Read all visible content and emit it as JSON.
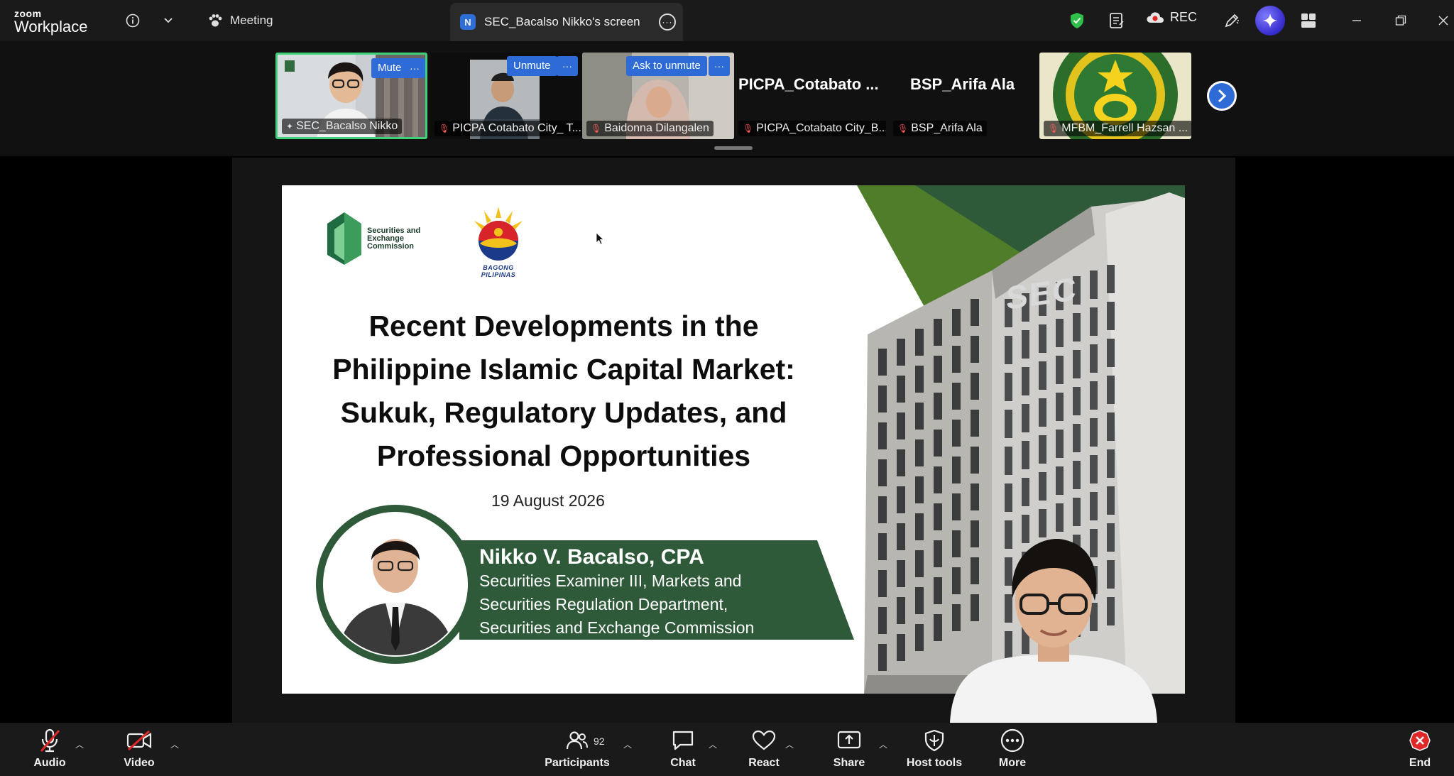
{
  "titlebar": {
    "brand_small": "zoom",
    "brand_large": "Workplace",
    "meeting_tab": "Meeting",
    "screen_tab": "SEC_Bacalso Nikko's screen",
    "screen_tab_badge": "N",
    "rec": "REC"
  },
  "gallery": {
    "tiles": [
      {
        "name": "SEC_Bacalso Nikko",
        "button": "Mute"
      },
      {
        "name": "PICPA Cotabato City_ T...",
        "button": "Unmute"
      },
      {
        "name": "Baidonna Dilangalen",
        "button": "Ask to unmute"
      },
      {
        "name": "PICPA_Cotabato City_B...",
        "display": "PICPA_Cotabato ..."
      },
      {
        "name": "BSP_Arifa Ala",
        "display": "BSP_Arifa Ala"
      },
      {
        "name": "MFBM_Farrell Hazsan ..."
      }
    ]
  },
  "slide": {
    "org_logo_text": [
      "Securities and",
      "Exchange",
      "Commission"
    ],
    "bp_logo_text": "BAGONG PILIPINAS",
    "title_lines": [
      "Recent Developments in the",
      "Philippine Islamic Capital Market:",
      "Sukuk, Regulatory Updates, and",
      "Professional Opportunities"
    ],
    "date": "19 August 2026",
    "speaker_name": "Nikko V. Bacalso, CPA",
    "speaker_role_lines": [
      "Securities Examiner III, Markets and",
      "Securities Regulation Department,",
      "Securities and Exchange Commission"
    ],
    "building_sign": "SEC"
  },
  "toolbar": {
    "audio": "Audio",
    "video": "Video",
    "participants": "Participants",
    "participants_count": "92",
    "chat": "Chat",
    "react": "React",
    "share": "Share",
    "host_tools": "Host tools",
    "more": "More",
    "end": "End"
  },
  "colors": {
    "accent_blue": "#2e6bd6",
    "active_speaker_border": "#3fd07a",
    "slide_green_dark": "#2f5a3a",
    "slide_green_mid": "#4f7d2a",
    "end_red": "#e02828"
  }
}
